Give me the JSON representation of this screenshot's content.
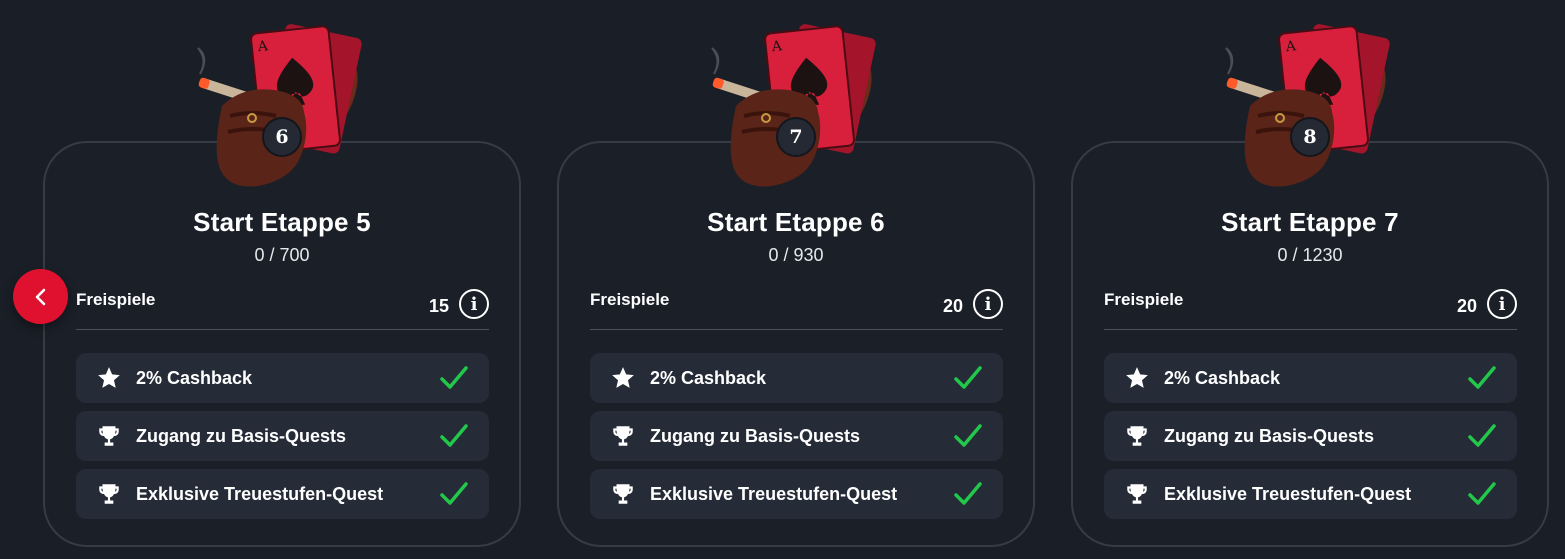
{
  "navigation": {
    "prev_icon": "chevron-left-icon",
    "accent_color": "#e0112f"
  },
  "colors": {
    "background": "#1a1e26",
    "card": "#1b1f28",
    "perk_row": "#252b37",
    "check": "#22c84a",
    "card_art_red": "#d8203c"
  },
  "cards": [
    {
      "level": "6",
      "title": "Start Etappe 5",
      "progress": "0 / 700",
      "freispiele_label": "Freispiele",
      "freispiele_value": "15",
      "perks": [
        {
          "icon": "star-icon",
          "label": "2% Cashback"
        },
        {
          "icon": "trophy-icon",
          "label": "Zugang zu Basis-Quests"
        },
        {
          "icon": "trophy-icon",
          "label": "Exklusive Treuestufen-Quest"
        }
      ]
    },
    {
      "level": "7",
      "title": "Start Etappe 6",
      "progress": "0 / 930",
      "freispiele_label": "Freispiele",
      "freispiele_value": "20",
      "perks": [
        {
          "icon": "star-icon",
          "label": "2% Cashback"
        },
        {
          "icon": "trophy-icon",
          "label": "Zugang zu Basis-Quests"
        },
        {
          "icon": "trophy-icon",
          "label": "Exklusive Treuestufen-Quest"
        }
      ]
    },
    {
      "level": "8",
      "title": "Start Etappe 7",
      "progress": "0 / 1230",
      "freispiele_label": "Freispiele",
      "freispiele_value": "20",
      "perks": [
        {
          "icon": "star-icon",
          "label": "2% Cashback"
        },
        {
          "icon": "trophy-icon",
          "label": "Zugang zu Basis-Quests"
        },
        {
          "icon": "trophy-icon",
          "label": "Exklusive Treuestufen-Quest"
        }
      ]
    }
  ]
}
